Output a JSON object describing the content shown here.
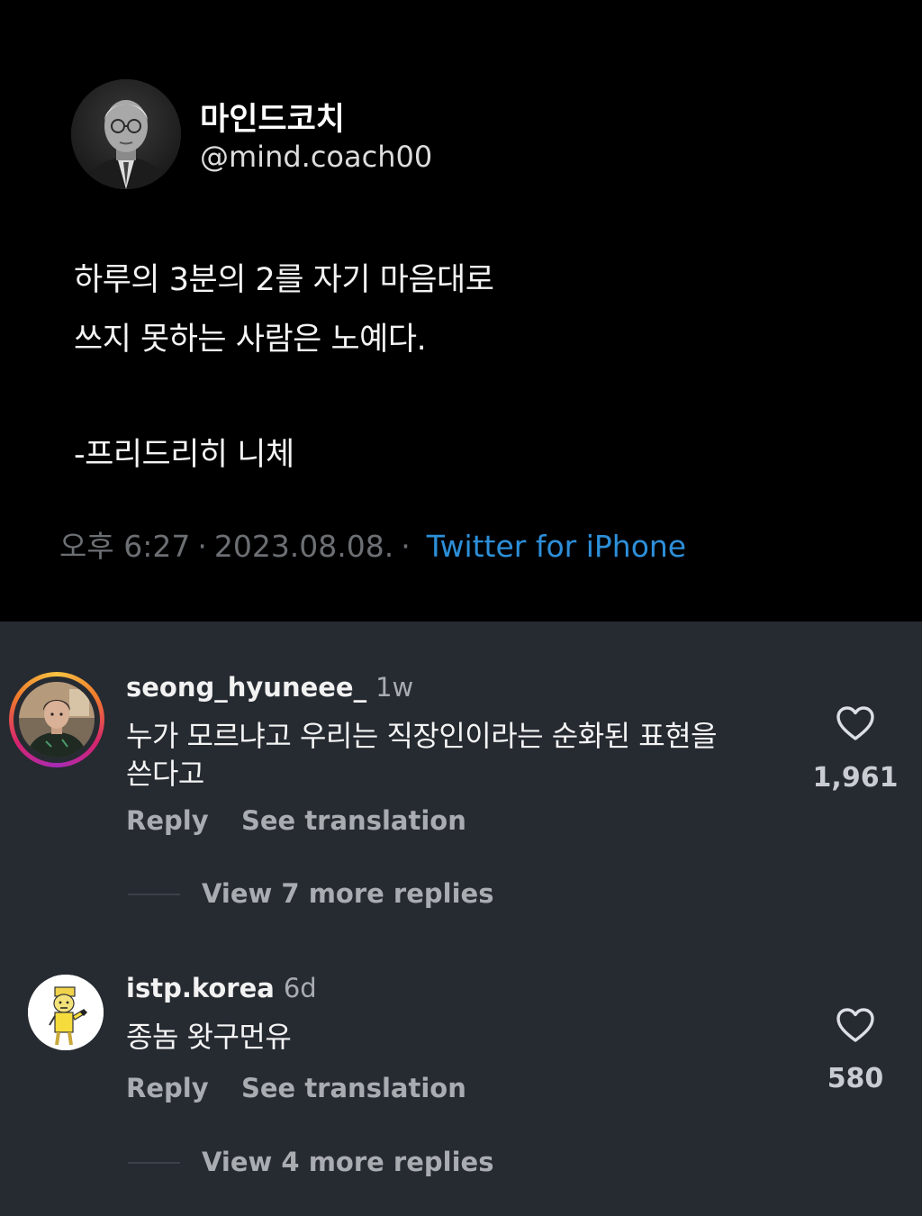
{
  "tweet": {
    "display_name": "마인드코치",
    "handle": "@mind.coach00",
    "lines": [
      "하루의 3분의 2를 자기 마음대로",
      "쓰지 못하는 사람은 노예다.",
      "-프리드리히 니체"
    ],
    "time": "오후 6:27",
    "date": "2023.08.08.",
    "separator": "·",
    "source": "Twitter for iPhone",
    "source_color": "#2d8fd9"
  },
  "comments": [
    {
      "username": "seong_hyuneee_",
      "time_ago": "1w",
      "text_lines": [
        "누가 모르냐고 우리는 직장인이라는 순화된 표현을",
        "쓴다고"
      ],
      "reply_label": "Reply",
      "translate_label": "See translation",
      "likes": "1,961",
      "view_replies": "View 7 more replies",
      "avatar_icon": "profile-photo",
      "has_story_ring": true
    },
    {
      "username": "istp.korea",
      "time_ago": "6d",
      "text_lines": [
        "종놈 왓구먼유"
      ],
      "reply_label": "Reply",
      "translate_label": "See translation",
      "likes": "580",
      "view_replies": "View 4 more replies",
      "avatar_icon": "cartoon-character",
      "has_story_ring": false
    }
  ],
  "icons": {
    "like": "heart-outline-icon"
  },
  "colors": {
    "tweet_background": "#000000",
    "comments_background": "#262a31",
    "muted_text": "#a9acb1"
  }
}
